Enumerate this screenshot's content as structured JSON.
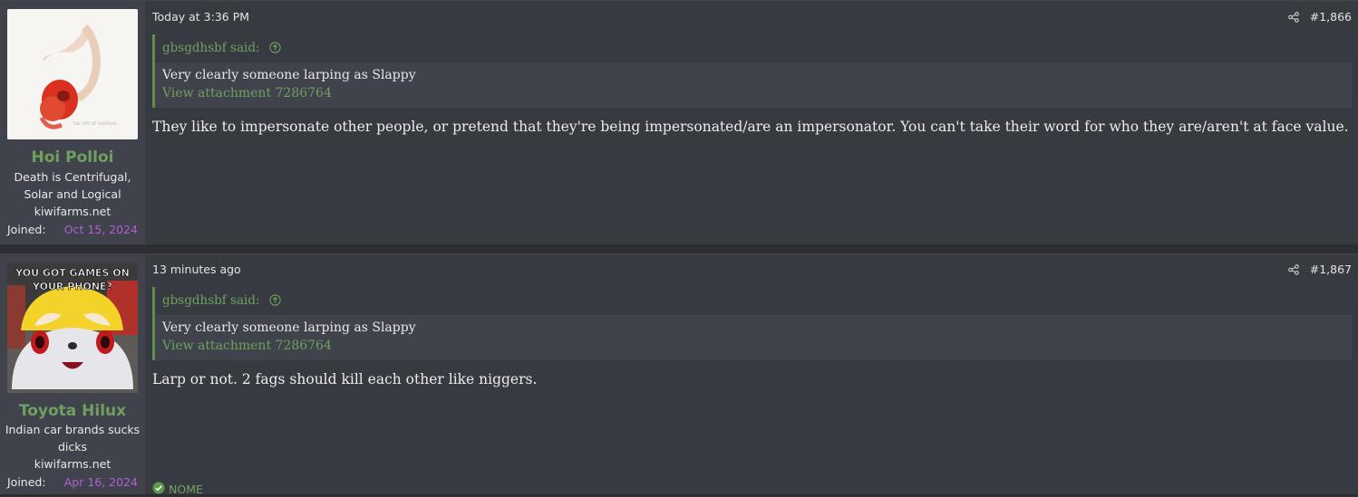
{
  "posts": [
    {
      "username": "Hoi Polloi",
      "user_title": "Death is Centrifugal, Solar and Logical",
      "site": "kiwifarms.net",
      "joined_label": "Joined:",
      "joined_date": "Oct 15, 2024",
      "time": "Today at 3:36 PM",
      "post_number": "#1,866",
      "quote_author": "gbsgdhsbf said:",
      "quote_text": "Very clearly someone larping as Slappy",
      "quote_link": "View attachment 7286764",
      "body": "They like to impersonate other people, or pretend that they're being impersonated/are an impersonator. You can't take their word for who they are/aren't at face value.",
      "avatar_caption": "THE ART OF SURPLUS"
    },
    {
      "username": "Toyota Hilux",
      "user_title": "Indian car brands sucks dicks",
      "site": "kiwifarms.net",
      "joined_label": "Joined:",
      "joined_date": "Apr 16, 2024",
      "time": "13 minutes ago",
      "post_number": "#1,867",
      "quote_author": "gbsgdhsbf said:",
      "quote_text": "Very clearly someone larping as Slappy",
      "quote_link": "View attachment 7286764",
      "body": "Larp or not. 2 fags should kill each other like niggers.",
      "avatar_caption_line1": "YOU GOT GAMES ON",
      "avatar_caption_line2": "YOUR PHONE?",
      "reaction": "NOME"
    }
  ]
}
